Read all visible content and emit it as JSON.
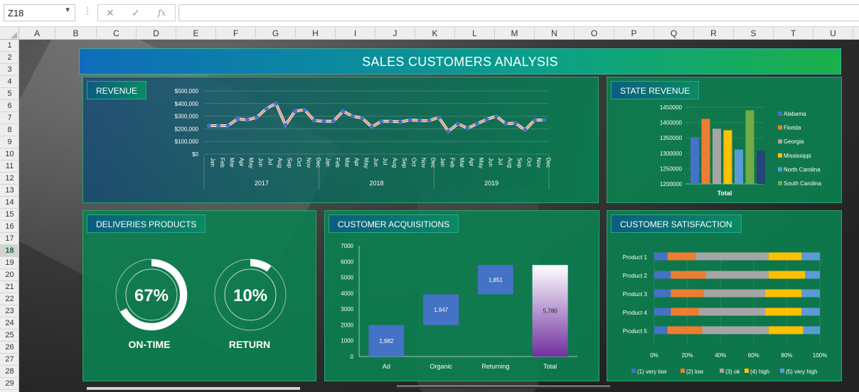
{
  "formula_bar": {
    "name_box": "Z18",
    "cancel_icon": "✕",
    "enter_icon": "✓",
    "fx_icon": "fx",
    "formula": ""
  },
  "columns": [
    "A",
    "B",
    "C",
    "D",
    "E",
    "F",
    "G",
    "H",
    "I",
    "J",
    "K",
    "L",
    "M",
    "N",
    "O",
    "P",
    "Q",
    "R",
    "S",
    "T",
    "U"
  ],
  "rows": [
    "1",
    "2",
    "3",
    "4",
    "5",
    "6",
    "7",
    "8",
    "9",
    "10",
    "11",
    "12",
    "13",
    "14",
    "15",
    "16",
    "17",
    "18",
    "19",
    "20",
    "21",
    "22",
    "23",
    "24",
    "25",
    "26",
    "27",
    "28",
    "29"
  ],
  "selected_row": "18",
  "dashboard": {
    "title": "SALES CUSTOMERS ANALYSIS",
    "revenue": {
      "tag": "REVENUE",
      "chart_data": {
        "type": "line",
        "yticks": [
          "$500,000",
          "$400,000",
          "$300,000",
          "$200,000",
          "$100,000",
          "$0"
        ],
        "ylim": [
          0,
          500000
        ],
        "months": [
          "Jan",
          "Feb",
          "Mar",
          "Apr",
          "May",
          "Jun",
          "Jul",
          "Aug",
          "Sep",
          "Oct",
          "Nov",
          "Dec"
        ],
        "years": [
          "2017",
          "2018",
          "2019"
        ],
        "values": [
          225000,
          225000,
          225000,
          280000,
          270000,
          290000,
          360000,
          400000,
          230000,
          340000,
          350000,
          265000,
          260000,
          260000,
          340000,
          300000,
          285000,
          215000,
          260000,
          260000,
          255000,
          270000,
          265000,
          265000,
          290000,
          180000,
          240000,
          205000,
          240000,
          275000,
          300000,
          240000,
          245000,
          190000,
          270000,
          270000
        ],
        "line_color": "#f08a7a",
        "marker_color": "#4472c4"
      }
    },
    "state_revenue": {
      "tag": "STATE REVENUE",
      "chart_data": {
        "type": "bar",
        "category": "Total",
        "yticks": [
          "1450000",
          "1400000",
          "1350000",
          "1300000",
          "1250000",
          "1200000"
        ],
        "ylim": [
          1200000,
          1450000
        ],
        "series": [
          {
            "name": "Alabama",
            "value": 1352000,
            "color": "#4472c4"
          },
          {
            "name": "Florida",
            "value": 1412000,
            "color": "#ed7d31"
          },
          {
            "name": "Georgia",
            "value": 1380000,
            "color": "#a5a5a5"
          },
          {
            "name": "Mississippi",
            "value": 1375000,
            "color": "#ffc000"
          },
          {
            "name": "North Carolina",
            "value": 1312000,
            "color": "#5b9bd5"
          },
          {
            "name": "South Carolina",
            "value": 1440000,
            "color": "#70ad47"
          },
          {
            "name": "",
            "value": 1308000,
            "color": "#264478"
          }
        ]
      }
    },
    "deliveries": {
      "tag": "DELIVERIES PRODUCTS",
      "on_time_value": "67%",
      "on_time_fraction": 0.67,
      "on_time_label": "ON-TIME",
      "return_value": "10%",
      "return_fraction": 0.1,
      "return_label": "RETURN"
    },
    "acquisitions": {
      "tag": "CUSTOMER ACQUISITIONS",
      "chart_data": {
        "type": "bar",
        "categories": [
          "Ad",
          "Organic",
          "Returning",
          "Total"
        ],
        "values": [
          1982,
          1947,
          1851,
          5780
        ],
        "labels": [
          "1,982",
          "1,947",
          "1,851",
          "5,780"
        ],
        "yticks": [
          "7000",
          "6000",
          "5000",
          "4000",
          "3000",
          "2000",
          "1000",
          "0"
        ],
        "ylim": [
          0,
          7000
        ]
      }
    },
    "satisfaction": {
      "tag": "CUSTOMER SATISFACTION",
      "chart_data": {
        "type": "bar",
        "stacked": true,
        "orientation": "horizontal",
        "categories": [
          "Product 1",
          "Product 2",
          "Product 3",
          "Product 4",
          "Product 5"
        ],
        "xticks": [
          "0%",
          "20%",
          "40%",
          "60%",
          "80%",
          "100%"
        ],
        "series": [
          {
            "name": "(1) very low",
            "color": "#4472c4",
            "values": [
              8,
              10,
              10,
              10,
              8
            ]
          },
          {
            "name": "(2) low",
            "color": "#ed7d31",
            "values": [
              17,
              21,
              20,
              17,
              21
            ]
          },
          {
            "name": "(3) ok",
            "color": "#a5a5a5",
            "values": [
              44,
              38,
              37,
              40,
              40
            ]
          },
          {
            "name": "(4) high",
            "color": "#ffc000",
            "values": [
              20,
              22,
              22,
              22,
              21
            ]
          },
          {
            "name": "(5) very high",
            "color": "#5b9bd5",
            "values": [
              11,
              9,
              11,
              11,
              10
            ]
          }
        ]
      }
    }
  }
}
